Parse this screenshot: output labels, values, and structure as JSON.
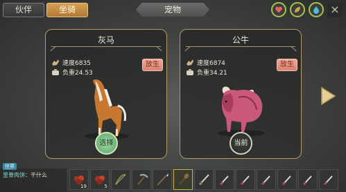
{
  "header": {
    "tabs": [
      {
        "label": "伙伴",
        "active": false
      },
      {
        "label": "坐骑",
        "active": true
      }
    ],
    "title": "宠物",
    "icons": [
      "heart-icon",
      "leaf-icon",
      "water-drop-icon"
    ],
    "close_label": "×"
  },
  "mounts": [
    {
      "name": "灰马",
      "speed": "速度6835",
      "load": "负重24.53",
      "release_label": "放生",
      "action_label": "选择",
      "creature": "horse"
    },
    {
      "name": "公牛",
      "speed": "速度6874",
      "load": "负重34.21",
      "release_label": "放生",
      "action_label": "当前",
      "creature": "bull"
    }
  ],
  "chat": {
    "channel": "世界",
    "speaker": "里脊肉饼",
    "message": "：干什么"
  },
  "hotbar": {
    "slots": [
      {
        "item": "berries",
        "count": "19"
      },
      {
        "item": "berries",
        "count": "5"
      },
      {
        "item": "bow",
        "count": ""
      },
      {
        "item": "pickaxe",
        "count": ""
      },
      {
        "item": "spear",
        "count": ""
      },
      {
        "item": "club",
        "count": "",
        "selected": true
      },
      {
        "item": "sword",
        "count": ""
      },
      {
        "item": "knife",
        "count": ""
      },
      {
        "item": "knife",
        "count": ""
      },
      {
        "item": "knife",
        "count": ""
      },
      {
        "item": "knife",
        "count": ""
      },
      {
        "item": "knife",
        "count": ""
      },
      {
        "item": "knife",
        "count": ""
      }
    ]
  },
  "colors": {
    "accent": "#d19a52",
    "release": "#e49382",
    "select": "#7cc085"
  }
}
